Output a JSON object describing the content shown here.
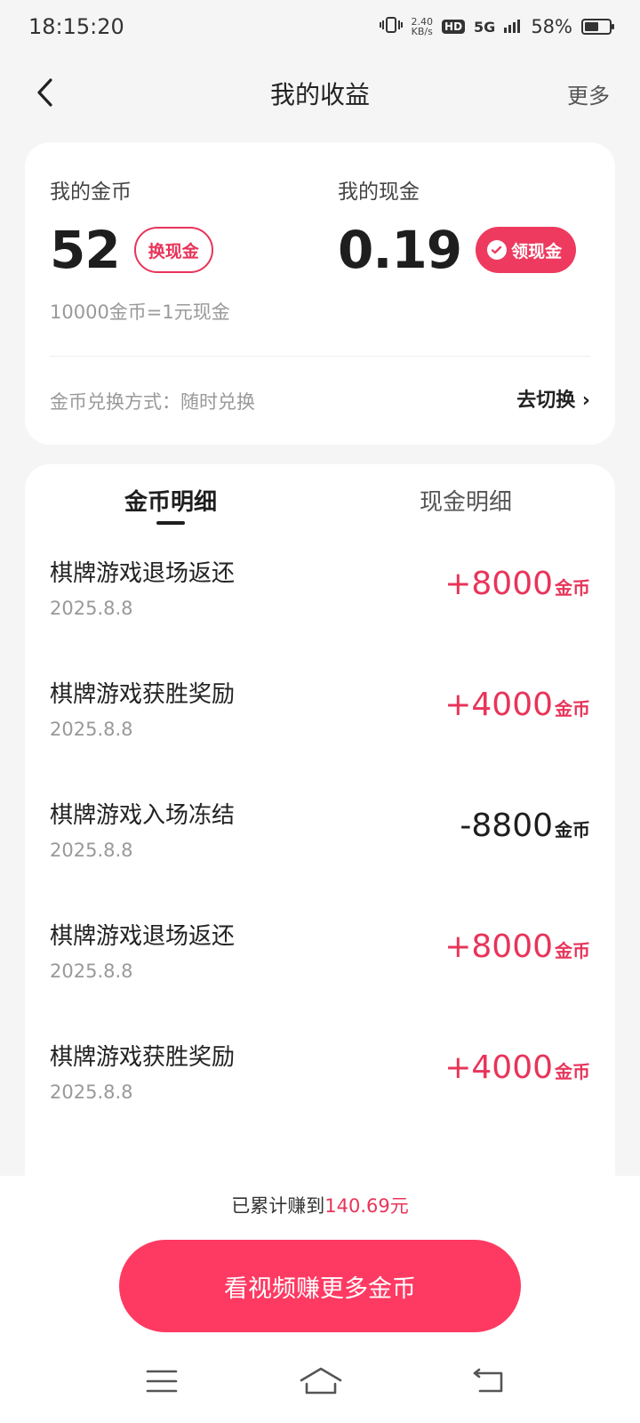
{
  "status_bar": {
    "time": "18:15:20",
    "net_speed_value": "2.40",
    "net_speed_unit": "KB/s",
    "hd_badge": "HD",
    "signal": "5G",
    "battery_percent": "58%",
    "battery_level": 0.58
  },
  "nav": {
    "title": "我的收益",
    "more": "更多"
  },
  "balance": {
    "coins_label": "我的金币",
    "coins_value": "52",
    "exchange_button": "换现金",
    "cash_label": "我的现金",
    "cash_value": "0.19",
    "withdraw_button": "领现金",
    "rate_text": "10000金币=1元现金",
    "method_text": "金币兑换方式：随时兑换",
    "switch_text": "去切换 ›"
  },
  "tabs": {
    "active": "金币明细",
    "inactive": "现金明细"
  },
  "records": [
    {
      "desc": "棋牌游戏退场返还",
      "date": "2025.8.8",
      "amount": "+8000",
      "unit": "金币",
      "sign": "pos"
    },
    {
      "desc": "棋牌游戏获胜奖励",
      "date": "2025.8.8",
      "amount": "+4000",
      "unit": "金币",
      "sign": "pos"
    },
    {
      "desc": "棋牌游戏入场冻结",
      "date": "2025.8.8",
      "amount": "-8800",
      "unit": "金币",
      "sign": "neg"
    },
    {
      "desc": "棋牌游戏退场返还",
      "date": "2025.8.8",
      "amount": "+8000",
      "unit": "金币",
      "sign": "pos"
    },
    {
      "desc": "棋牌游戏获胜奖励",
      "date": "2025.8.8",
      "amount": "+4000",
      "unit": "金币",
      "sign": "pos"
    }
  ],
  "footer": {
    "cumulative_prefix": "已累计赚到",
    "cumulative_value": "140.69元",
    "cta_button": "看视频赚更多金币"
  },
  "colors": {
    "accent": "#e8345a",
    "cta": "#fe3a63"
  }
}
